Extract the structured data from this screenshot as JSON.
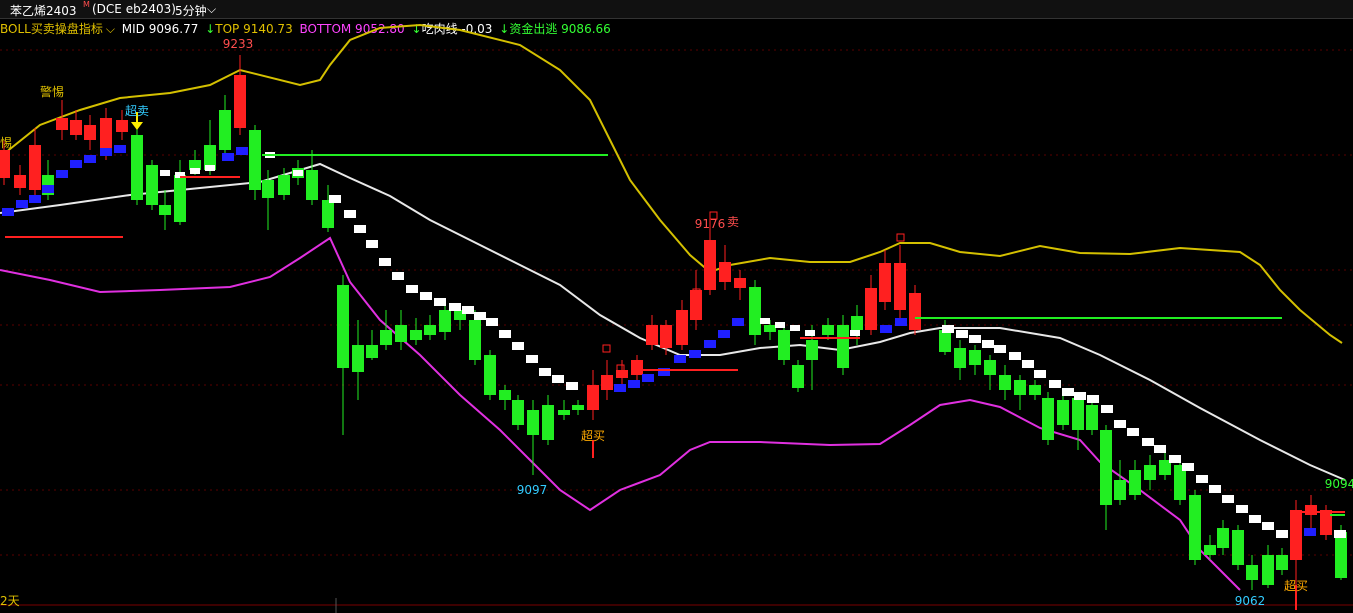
{
  "header": {
    "symbol": "苯乙烯2403",
    "marker": "M",
    "exchange_code": "(DCE eb2403)",
    "period": "5分钟",
    "dropdown_glyph": "⌵"
  },
  "legend": {
    "indicator": "BOLL买卖操盘指标",
    "mid": "MID 9096.77",
    "top": "TOP 9140.73",
    "bottom": "BOTTOM 9052.80",
    "chirou": "吃肉线 -0.03",
    "zijin": "资金出逃 9086.66",
    "arrow": "↓",
    "colors": {
      "indicator": "#e0c000",
      "mid": "#ffffff",
      "top": "#e0c000",
      "bottom": "#ff44ff",
      "chirou": "#ffffff",
      "zijin": "#33ff33",
      "arrow": "#33ff33"
    }
  },
  "chart_data": {
    "type": "candlestick",
    "price_labels": [
      {
        "text": "9233",
        "color": "#ff4d4d"
      },
      {
        "text": "9176",
        "color": "#ff4d4d"
      },
      {
        "text": "9097",
        "color": "#33ccff"
      },
      {
        "text": "9094",
        "color": "#33ff33"
      },
      {
        "text": "9062",
        "color": "#33ccff"
      }
    ],
    "signals": [
      {
        "text": "警惕",
        "color": "#e0c000"
      },
      {
        "text": "超卖",
        "color": "#33ccff"
      },
      {
        "text": "超买",
        "color": "#ffaa00"
      },
      {
        "text": "卖",
        "color": "#ff4d4d"
      },
      {
        "text": "超买",
        "color": "#ffaa00"
      },
      {
        "text": "惕",
        "color": "#e0c000"
      }
    ],
    "footer_left": "2天"
  }
}
